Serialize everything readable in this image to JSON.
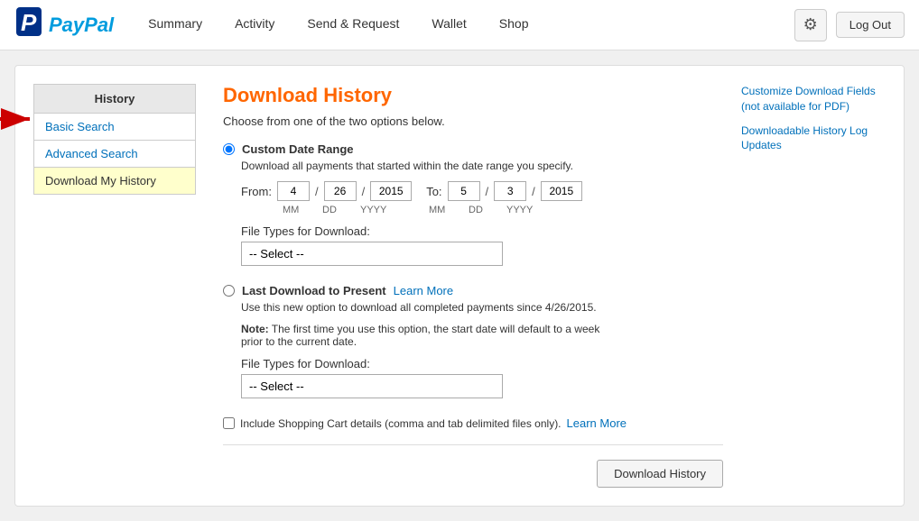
{
  "logo": {
    "p_char": "P",
    "brand_name": "PayPal"
  },
  "nav": {
    "items": [
      {
        "id": "summary",
        "label": "Summary"
      },
      {
        "id": "activity",
        "label": "Activity"
      },
      {
        "id": "send-request",
        "label": "Send & Request"
      },
      {
        "id": "wallet",
        "label": "Wallet"
      },
      {
        "id": "shop",
        "label": "Shop"
      }
    ],
    "logout_label": "Log Out"
  },
  "sidebar": {
    "title": "History",
    "links": [
      {
        "id": "basic-search",
        "label": "Basic Search"
      },
      {
        "id": "advanced-search",
        "label": "Advanced Search"
      }
    ],
    "active_item": "Download My History"
  },
  "page": {
    "title": "Download History",
    "intro": "Choose from one of the two options below.",
    "option1": {
      "label": "Custom Date Range",
      "description": "Download all payments that started within the date range you specify.",
      "from_label": "From:",
      "to_label": "To:",
      "from_mm": "4",
      "from_dd": "26",
      "from_yyyy": "2015",
      "to_mm": "5",
      "to_dd": "3",
      "to_yyyy": "2015",
      "mm_sublabel": "MM",
      "dd_sublabel": "DD",
      "yyyy_sublabel": "YYYY",
      "file_types_label": "File Types for Download:",
      "select_placeholder": "-- Select --"
    },
    "option2": {
      "label": "Last Download to Present",
      "learn_more_label": "Learn More",
      "description": "Use this new option to download all completed payments since 4/26/2015.",
      "note_label": "Note:",
      "note_text": "The first time you use this option, the start date will default to a week prior to the current date.",
      "file_types_label": "File Types for Download:",
      "select_placeholder": "-- Select --"
    },
    "checkbox_label": "Include Shopping Cart details (comma and tab delimited files only).",
    "checkbox_learn_more": "Learn More",
    "download_button": "Download History"
  },
  "right_links": [
    {
      "id": "customize-fields",
      "label": "Customize Download Fields (not available for PDF)"
    },
    {
      "id": "downloadable-history",
      "label": "Downloadable History Log Updates"
    }
  ]
}
